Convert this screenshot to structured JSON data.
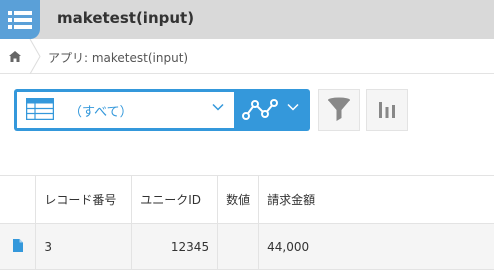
{
  "header": {
    "title": "maketest(input)",
    "app_icon": "list-icon"
  },
  "breadcrumb": {
    "home_icon": "home-icon",
    "app_label": "アプリ: maketest(input)"
  },
  "toolbar": {
    "view_label": "（すべて）",
    "view_icon": "table-view-icon",
    "graph_icon": "line-graph-icon",
    "filter_icon": "filter-icon",
    "chart_icon": "bar-chart-icon",
    "accent_color": "#3498db"
  },
  "table": {
    "columns": [
      "レコード番号",
      "ユニークID",
      "数値",
      "請求金額"
    ],
    "rows": [
      {
        "detail_icon": "document-icon",
        "cells": [
          "3",
          "12345",
          "",
          "44,000"
        ]
      }
    ]
  }
}
